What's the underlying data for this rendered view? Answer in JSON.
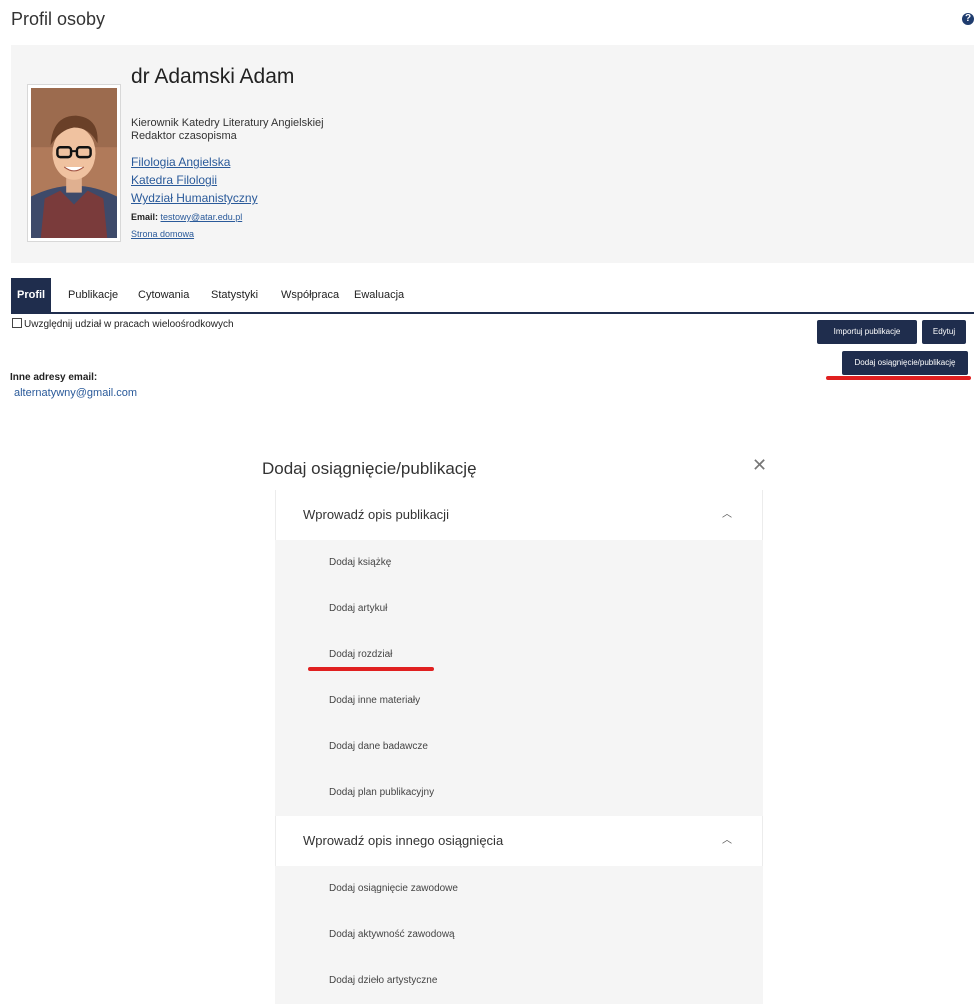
{
  "page": {
    "title": "Profil osoby",
    "help_icon": "question-circle-icon"
  },
  "profile": {
    "name": "dr Adamski Adam",
    "roles": [
      "Kierownik Katedry Literatury Angielskiej",
      "Redaktor czasopisma"
    ],
    "units": [
      "Filologia Angielska",
      "Katedra Filologii",
      "Wydział Humanistyczny"
    ],
    "email_label": "Email:",
    "email": "testowy@atar.edu.pl",
    "homepage": "Strona domowa"
  },
  "tabs": [
    {
      "label": "Profil",
      "active": true
    },
    {
      "label": "Publikacje"
    },
    {
      "label": "Cytowania"
    },
    {
      "label": "Statystyki"
    },
    {
      "label": "Współpraca"
    },
    {
      "label": "Ewaluacja"
    }
  ],
  "checkbox_label": "Uwzględnij udział w pracach wieloośrodkowych",
  "buttons": {
    "import": "Importuj publikacje",
    "edit": "Edytuj",
    "add": "Dodaj osiągnięcie/publikację"
  },
  "other_emails": {
    "label": "Inne adresy email:",
    "values": [
      "alternatywny@gmail.com"
    ]
  },
  "modal": {
    "title": "Dodaj osiągnięcie/publikację",
    "close_icon": "close-icon",
    "sections": [
      {
        "header": "Wprowadź opis publikacji",
        "items": [
          "Dodaj książkę",
          "Dodaj artykuł",
          "Dodaj rozdział",
          "Dodaj inne materiały",
          "Dodaj dane badawcze",
          "Dodaj plan publikacyjny"
        ]
      },
      {
        "header": "Wprowadź opis innego osiągnięcia",
        "items": [
          "Dodaj osiągnięcie zawodowe",
          "Dodaj aktywność zawodową",
          "Dodaj dzieło artystyczne"
        ]
      }
    ]
  },
  "colors": {
    "primary": "#1f2d4d",
    "link": "#2a5a9a",
    "highlight": "#e02020",
    "panel": "#f5f5f5"
  }
}
